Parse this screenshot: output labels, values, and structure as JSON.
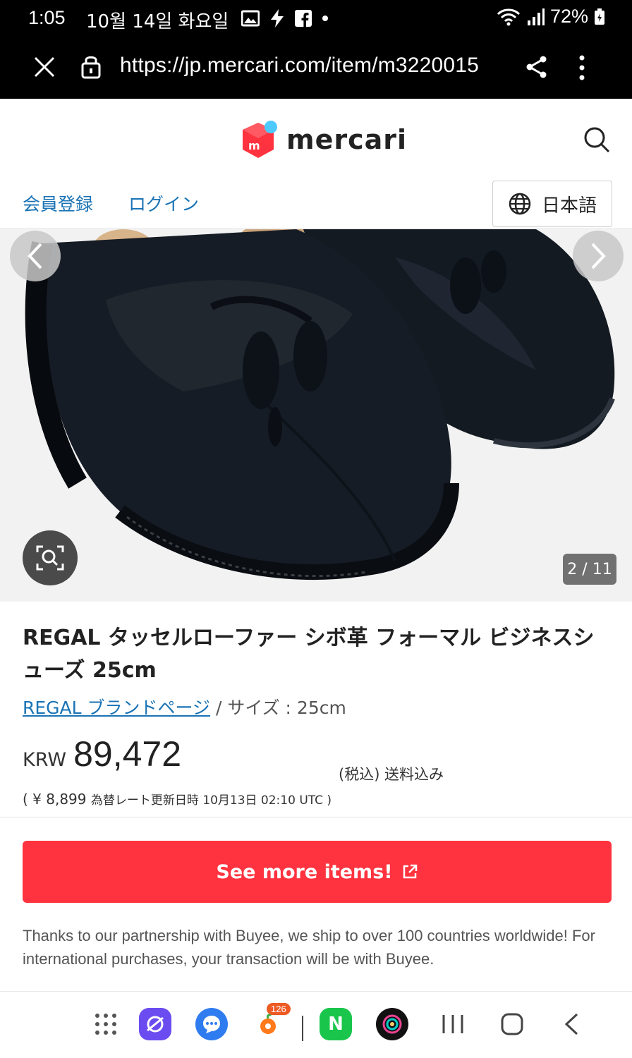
{
  "status_bar": {
    "time": "1:05",
    "date": "10월 14일 화요일",
    "battery": "72%"
  },
  "browser": {
    "url": "https://jp.mercari.com/item/m3220015"
  },
  "header": {
    "logo_text": "mercari",
    "nav": {
      "register": "会員登録",
      "login": "ログイン",
      "language": "日本語"
    }
  },
  "gallery": {
    "counter": "2 / 11"
  },
  "item": {
    "title": "REGAL タッセルローファー シボ革 フォーマル ビジネスシューズ 25cm",
    "brand_link": "REGAL ブランドページ",
    "separator": " / ",
    "size": "サイズ : 25cm",
    "currency": "KRW",
    "price": "89,472",
    "tax_note": "(税込) 送料込み",
    "yen_price": "( ¥ 8,899",
    "rate_note": "為替レート更新日時 10月13日 02:10 UTC )"
  },
  "cta": {
    "label": "See more items!"
  },
  "buyee_note": "Thanks to our partnership with Buyee, we ship to over 100 countries worldwide! For international purchases, your transaction will be with Buyee.",
  "dock": {
    "badge_count": "126",
    "naver_letter": "N"
  },
  "colors": {
    "brand_red": "#ff333f",
    "link_blue": "#1a73b5"
  }
}
